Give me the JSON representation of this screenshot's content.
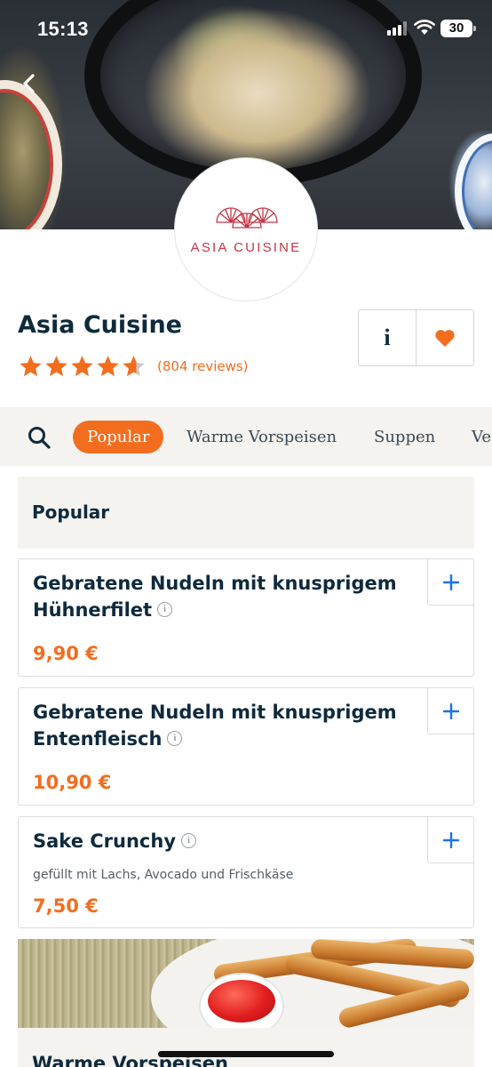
{
  "status_bar": {
    "time": "15:13",
    "battery": "30"
  },
  "restaurant": {
    "logo_text": "ASIA CUISINE",
    "name": "Asia Cuisine",
    "rating": 4.5,
    "reviews": "(804 reviews)",
    "info_label": "i"
  },
  "categories": {
    "tabs": [
      {
        "label": "Popular",
        "active": true
      },
      {
        "label": "Warme Vorspeisen",
        "active": false
      },
      {
        "label": "Suppen",
        "active": false
      },
      {
        "label": "Ve",
        "active": false
      }
    ]
  },
  "menu": {
    "section_title": "Popular",
    "items": [
      {
        "name": "Gebratene Nudeln mit knusprigem Hühnerfilet",
        "description": "",
        "price": "9,90 €"
      },
      {
        "name": "Gebratene Nudeln mit knusprigem Entenfleisch",
        "description": "",
        "price": "10,90 €"
      },
      {
        "name": "Sake Crunchy",
        "description": "gefüllt mit Lachs, Avocado und Frischkäse",
        "price": "7,50 €"
      }
    ],
    "next_section_title": "Warme Vorspeisen"
  },
  "colors": {
    "accent": "#f36d1f",
    "text": "#0e2a3d",
    "link_blue": "#1a73e8",
    "logo_red": "#c63645"
  },
  "icons": [
    "back-arrow-icon",
    "search-icon",
    "info-icon",
    "heart-icon",
    "plus-icon",
    "star-icon"
  ]
}
